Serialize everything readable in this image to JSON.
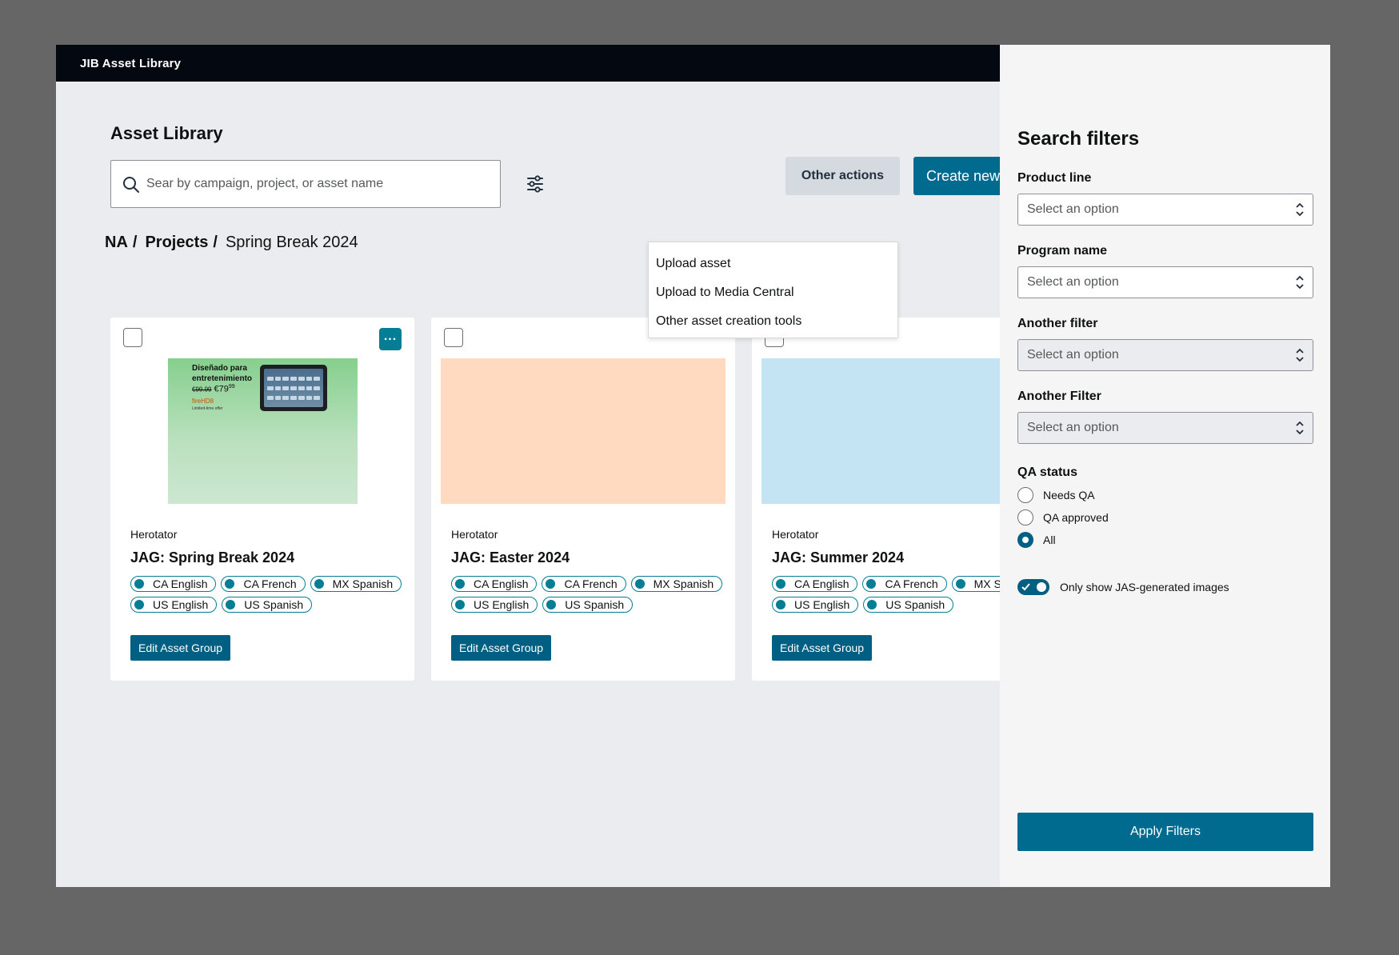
{
  "app": {
    "title": "JIB Asset Library"
  },
  "page": {
    "title": "Asset Library"
  },
  "search": {
    "placeholder": "Sear by campaign, project, or asset name",
    "value": ""
  },
  "toolbar": {
    "other_actions_label": "Other actions",
    "create_new_label": "Create new"
  },
  "actions_menu": {
    "items": [
      {
        "label": "Upload asset"
      },
      {
        "label": "Upload to Media Central"
      },
      {
        "label": "Other asset creation tools"
      }
    ]
  },
  "breadcrumb": {
    "region": "NA",
    "projects": "Projects",
    "current": "Spring Break 2024",
    "separator": "/"
  },
  "cards": [
    {
      "creator": "Herotator",
      "title": "JAG: Spring Break 2024",
      "thumb_color": "#86cf8e",
      "promo": {
        "line1": "Diseñado para",
        "line2": "entretenimiento",
        "old_price": "€99.99",
        "price": "€79",
        "price_cents": "99",
        "brand": "fireHD8",
        "tag": "Limited-time offer"
      },
      "chips": [
        "CA English",
        "CA French",
        "MX Spanish",
        "US English",
        "US Spanish"
      ],
      "edit_label": "Edit Asset Group"
    },
    {
      "creator": "Herotator",
      "title": "JAG: Easter 2024",
      "thumb_color": "#ffdac0",
      "chips": [
        "CA English",
        "CA French",
        "MX Spanish",
        "US English",
        "US Spanish"
      ],
      "edit_label": "Edit Asset Group"
    },
    {
      "creator": "Herotator",
      "title": "JAG: Summer 2024",
      "thumb_color": "#c4e3f3",
      "chips": [
        "CA English",
        "CA French",
        "MX Spanish",
        "US English",
        "US Spanish"
      ],
      "edit_label": "Edit Asset Group"
    }
  ],
  "filters": {
    "title": "Search filters",
    "product_line": {
      "label": "Product line",
      "value": "Select an option"
    },
    "program_name": {
      "label": "Program name",
      "value": "Select an option"
    },
    "another_filter": {
      "label": "Another filter",
      "value": "Select an option"
    },
    "another_filter_2": {
      "label": "Another Filter",
      "value": "Select an option"
    },
    "qa_status": {
      "label": "QA status",
      "options": [
        {
          "label": "Needs QA",
          "checked": false
        },
        {
          "label": "QA approved",
          "checked": false
        },
        {
          "label": "All",
          "checked": true
        }
      ]
    },
    "jas_toggle": {
      "label": "Only show JAS-generated images",
      "on": true
    },
    "apply_label": "Apply Filters"
  },
  "colors": {
    "accent": "#006b8f",
    "chip": "#047d95",
    "topbar": "#030811"
  },
  "icons": {
    "search": "search-icon",
    "filter": "sliders-icon",
    "more": "more-dots-icon",
    "select": "sort-arrows-icon",
    "check": "check-icon"
  }
}
